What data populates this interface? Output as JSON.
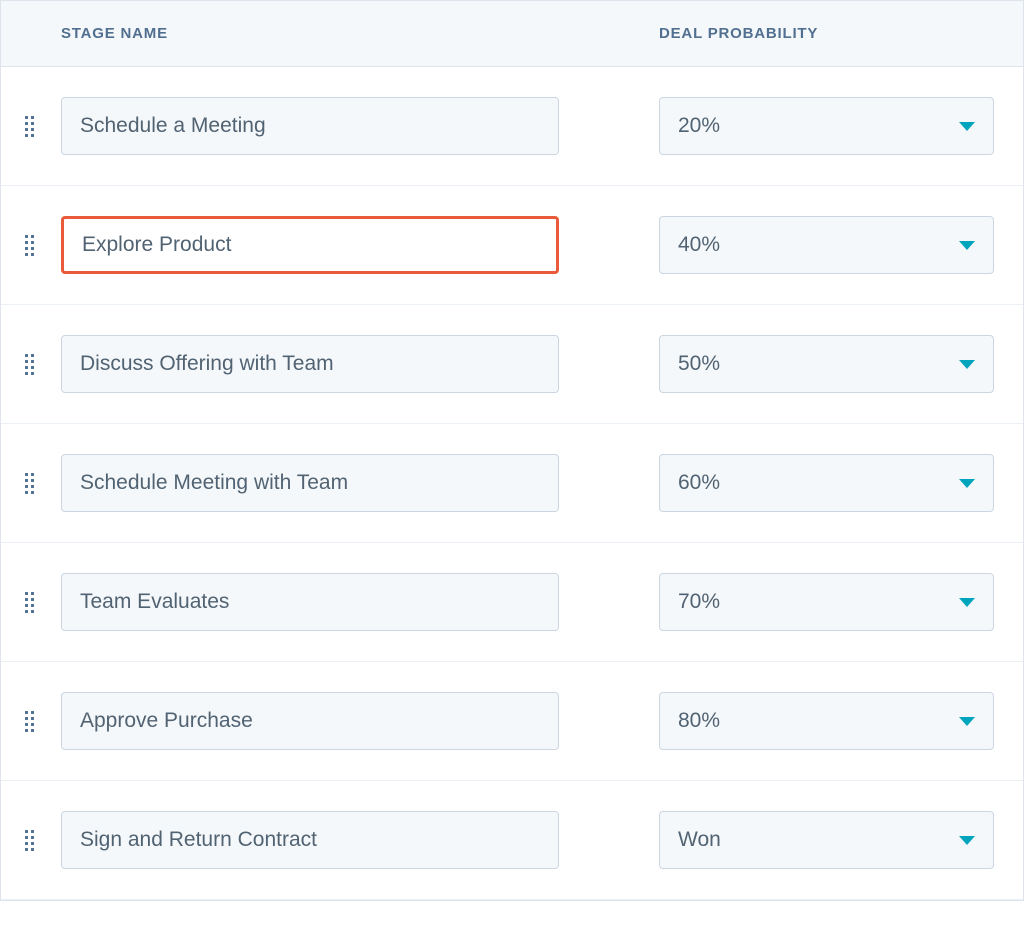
{
  "headers": {
    "stage_name": "STAGE NAME",
    "deal_probability": "DEAL PROBABILITY"
  },
  "rows": [
    {
      "name": "Schedule a Meeting",
      "probability": "20%",
      "highlighted": false
    },
    {
      "name": "Explore Product",
      "probability": "40%",
      "highlighted": true
    },
    {
      "name": "Discuss Offering with Team",
      "probability": "50%",
      "highlighted": false
    },
    {
      "name": "Schedule Meeting with Team",
      "probability": "60%",
      "highlighted": false
    },
    {
      "name": "Team Evaluates",
      "probability": "70%",
      "highlighted": false
    },
    {
      "name": "Approve Purchase",
      "probability": "80%",
      "highlighted": false
    },
    {
      "name": "Sign and Return Contract",
      "probability": "Won",
      "highlighted": false
    }
  ]
}
